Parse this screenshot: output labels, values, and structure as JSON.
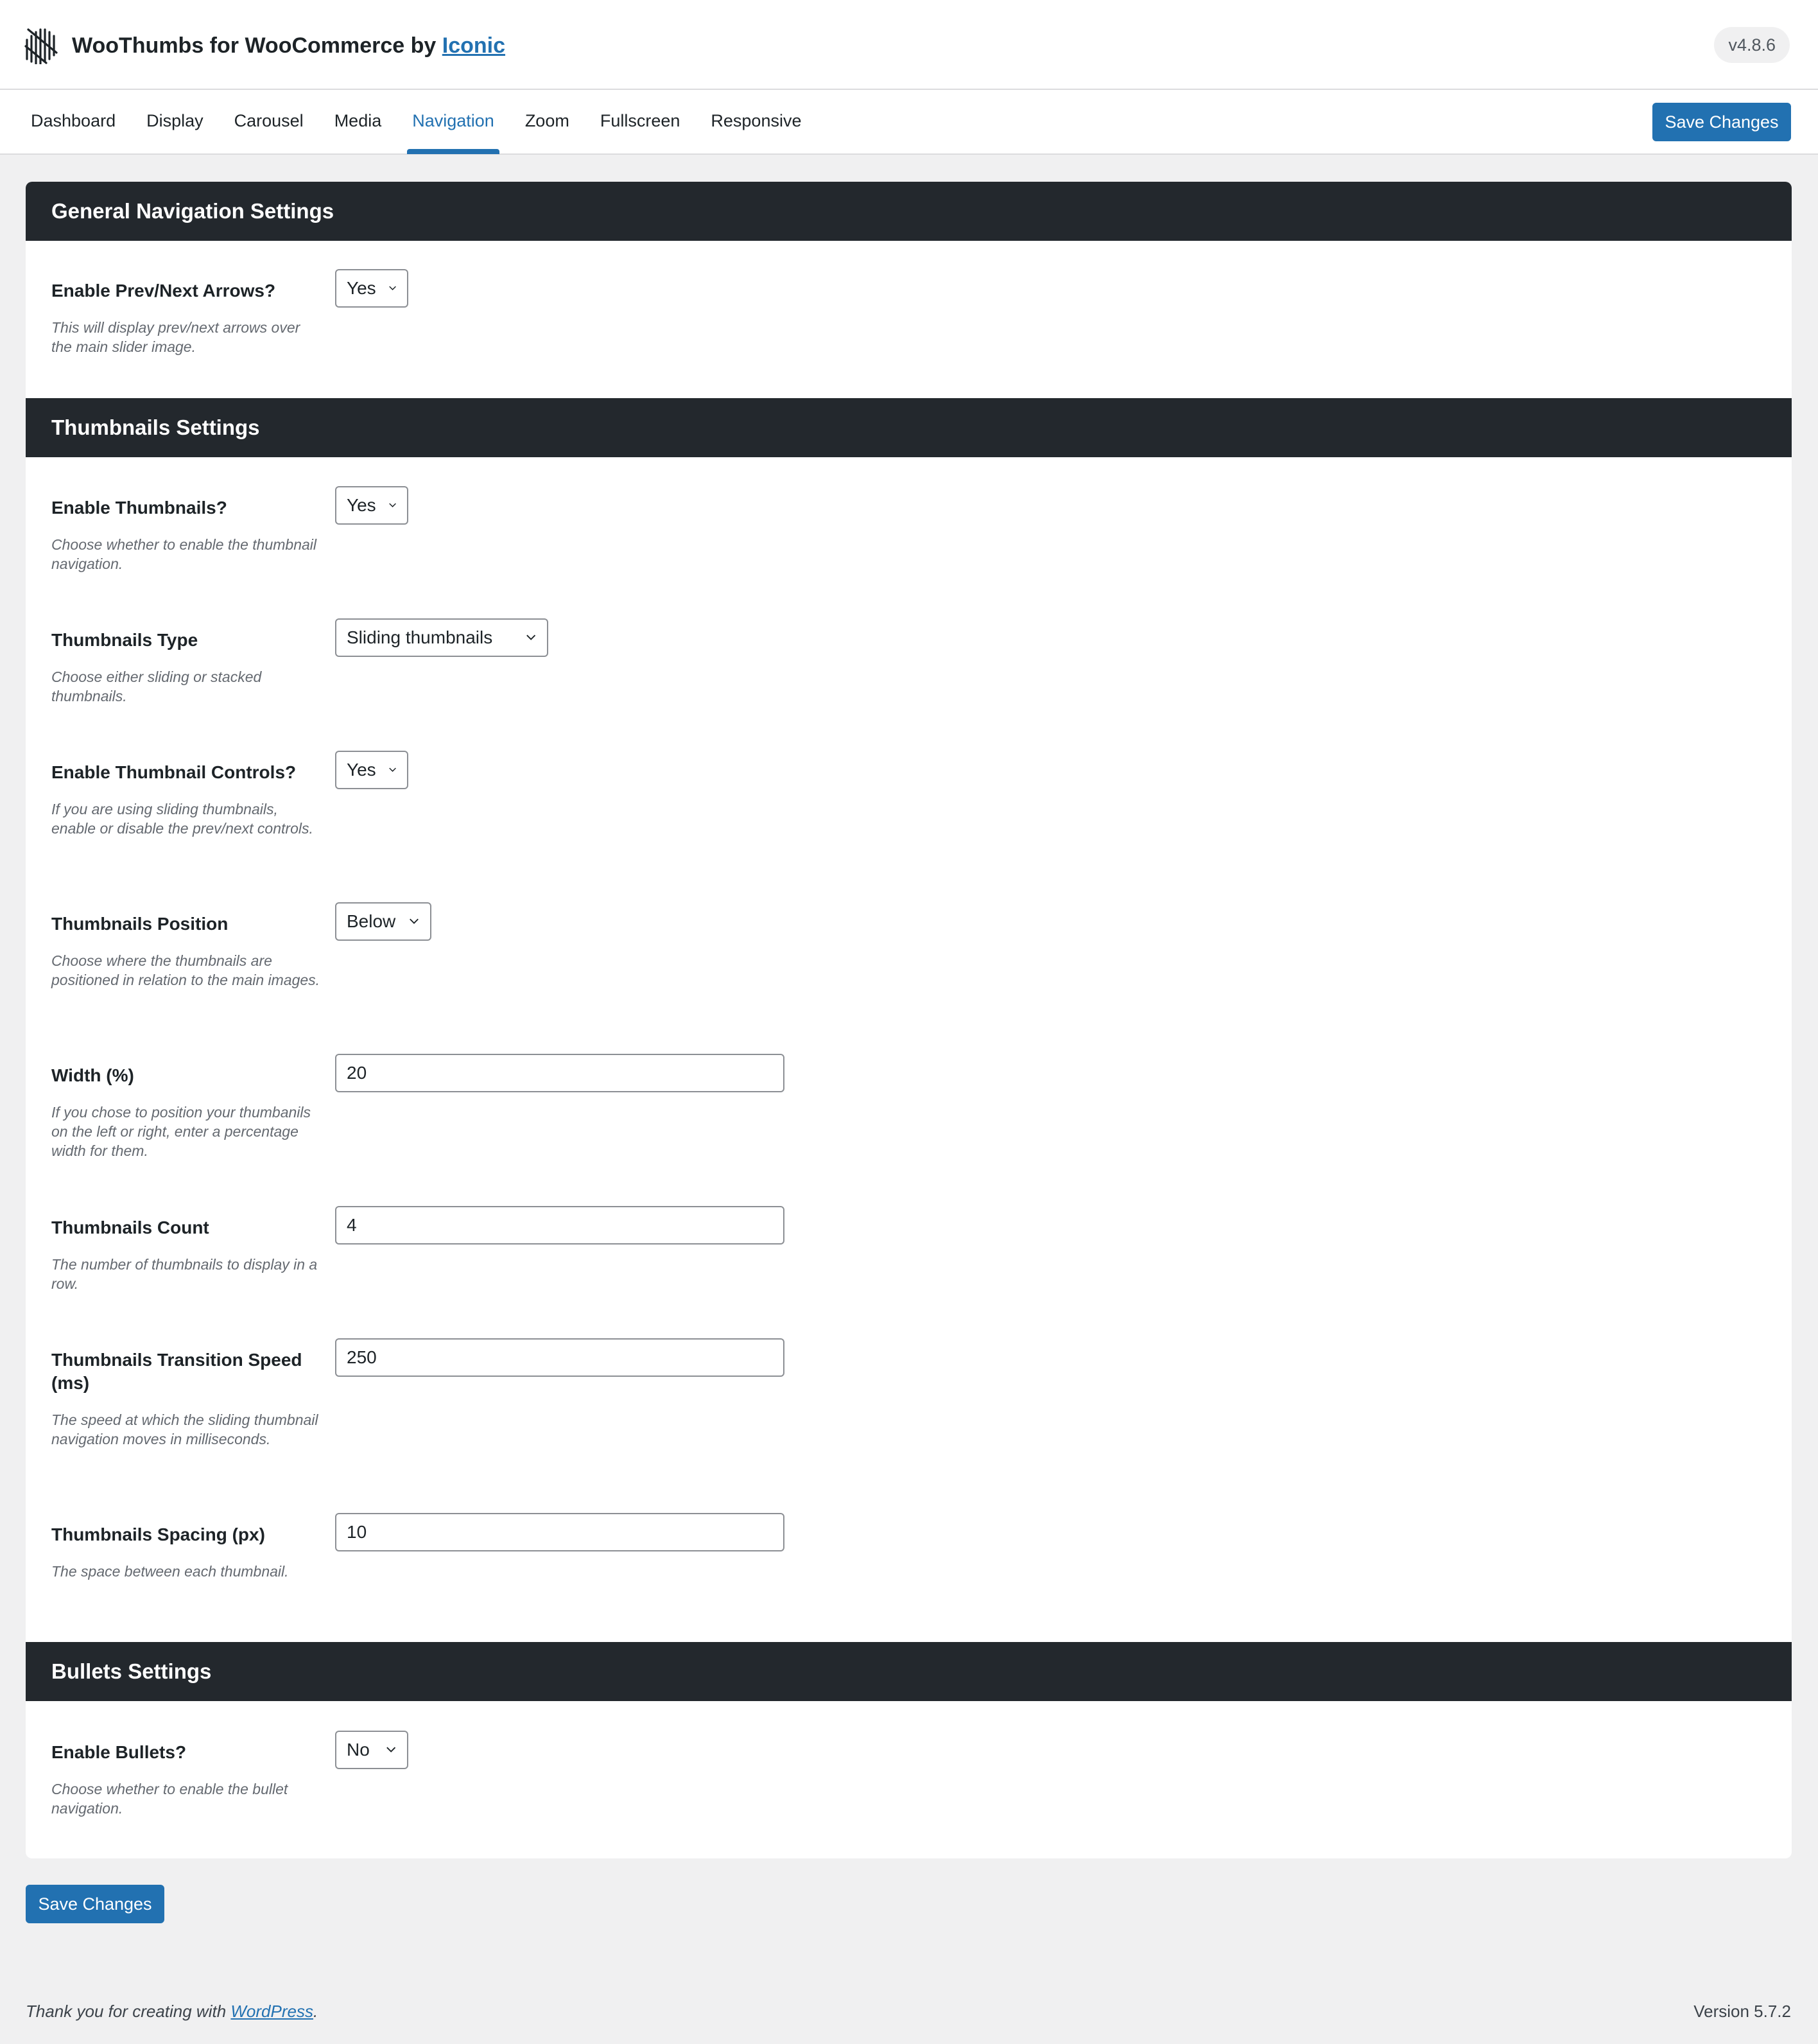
{
  "header": {
    "title": "WooThumbs for WooCommerce by",
    "title_link": "Iconic",
    "version": "v4.8.6",
    "logo_icon": "iconic-logo-icon"
  },
  "tabs": [
    {
      "label": "Dashboard",
      "active": false
    },
    {
      "label": "Display",
      "active": false
    },
    {
      "label": "Carousel",
      "active": false
    },
    {
      "label": "Media",
      "active": false
    },
    {
      "label": "Navigation",
      "active": true
    },
    {
      "label": "Zoom",
      "active": false
    },
    {
      "label": "Fullscreen",
      "active": false
    },
    {
      "label": "Responsive",
      "active": false
    }
  ],
  "save_label": "Save Changes",
  "sections": {
    "general": {
      "title": "General Navigation Settings",
      "enable_arrows": {
        "label": "Enable Prev/Next Arrows?",
        "description": "This will display prev/next arrows over the main slider image.",
        "value": "Yes"
      }
    },
    "thumbnails": {
      "title": "Thumbnails Settings",
      "enable": {
        "label": "Enable Thumbnails?",
        "description": "Choose whether to enable the thumbnail navigation.",
        "value": "Yes"
      },
      "type": {
        "label": "Thumbnails Type",
        "description": "Choose either sliding or stacked thumbnails.",
        "value": "Sliding thumbnails"
      },
      "controls": {
        "label": "Enable Thumbnail Controls?",
        "description": "If you are using sliding thumbnails, enable or disable the prev/next controls.",
        "value": "Yes"
      },
      "position": {
        "label": "Thumbnails Position",
        "description": "Choose where the thumbnails are positioned in relation to the main images.",
        "value": "Below"
      },
      "width": {
        "label": "Width (%)",
        "description": "If you chose to position your thumbanils on the left or right, enter a percentage width for them.",
        "value": "20"
      },
      "count": {
        "label": "Thumbnails Count",
        "description": "The number of thumbnails to display in a row.",
        "value": "4"
      },
      "speed": {
        "label": "Thumbnails Transition Speed (ms)",
        "description": "The speed at which the sliding thumbnail navigation moves in milliseconds.",
        "value": "250"
      },
      "spacing": {
        "label": "Thumbnails Spacing (px)",
        "description": "The space between each thumbnail.",
        "value": "10"
      }
    },
    "bullets": {
      "title": "Bullets Settings",
      "enable": {
        "label": "Enable Bullets?",
        "description": "Choose whether to enable the bullet navigation.",
        "value": "No"
      }
    }
  },
  "footer": {
    "thanks_prefix": "Thank you for creating with",
    "thanks_link": "WordPress",
    "thanks_suffix": ".",
    "version": "Version 5.7.2"
  },
  "colors": {
    "accent": "#2271b1",
    "section_header_bg": "#23282d",
    "page_bg": "#f0f0f1"
  }
}
